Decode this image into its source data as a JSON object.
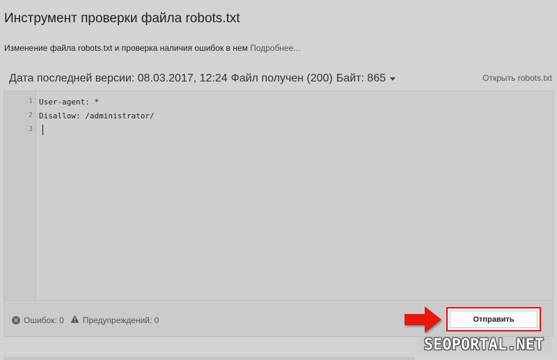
{
  "page": {
    "title": "Инструмент проверки файла robots.txt",
    "description": "Изменение файла robots.txt и проверка наличия ошибок в нем",
    "more_link": "Подробнее..."
  },
  "version": {
    "date_label": "Дата последней версии: 08.03.2017, 12:24",
    "status_label": "Файл получен (200)",
    "bytes_label": "Байт: 865",
    "open_link": "Открыть robots.txt"
  },
  "editor": {
    "line_numbers": [
      "1",
      "2",
      "3"
    ],
    "lines": [
      "User-agent: *",
      "Disallow: /administrator/",
      ""
    ]
  },
  "status": {
    "errors_label": "Ошибок: 0",
    "warnings_label": "Предупреждений: 0"
  },
  "submit_label": "Отправить",
  "watermark": "SEOPORTAL.NET",
  "colors": {
    "highlight_red": "#e01010",
    "background": "#d3d3d3"
  }
}
